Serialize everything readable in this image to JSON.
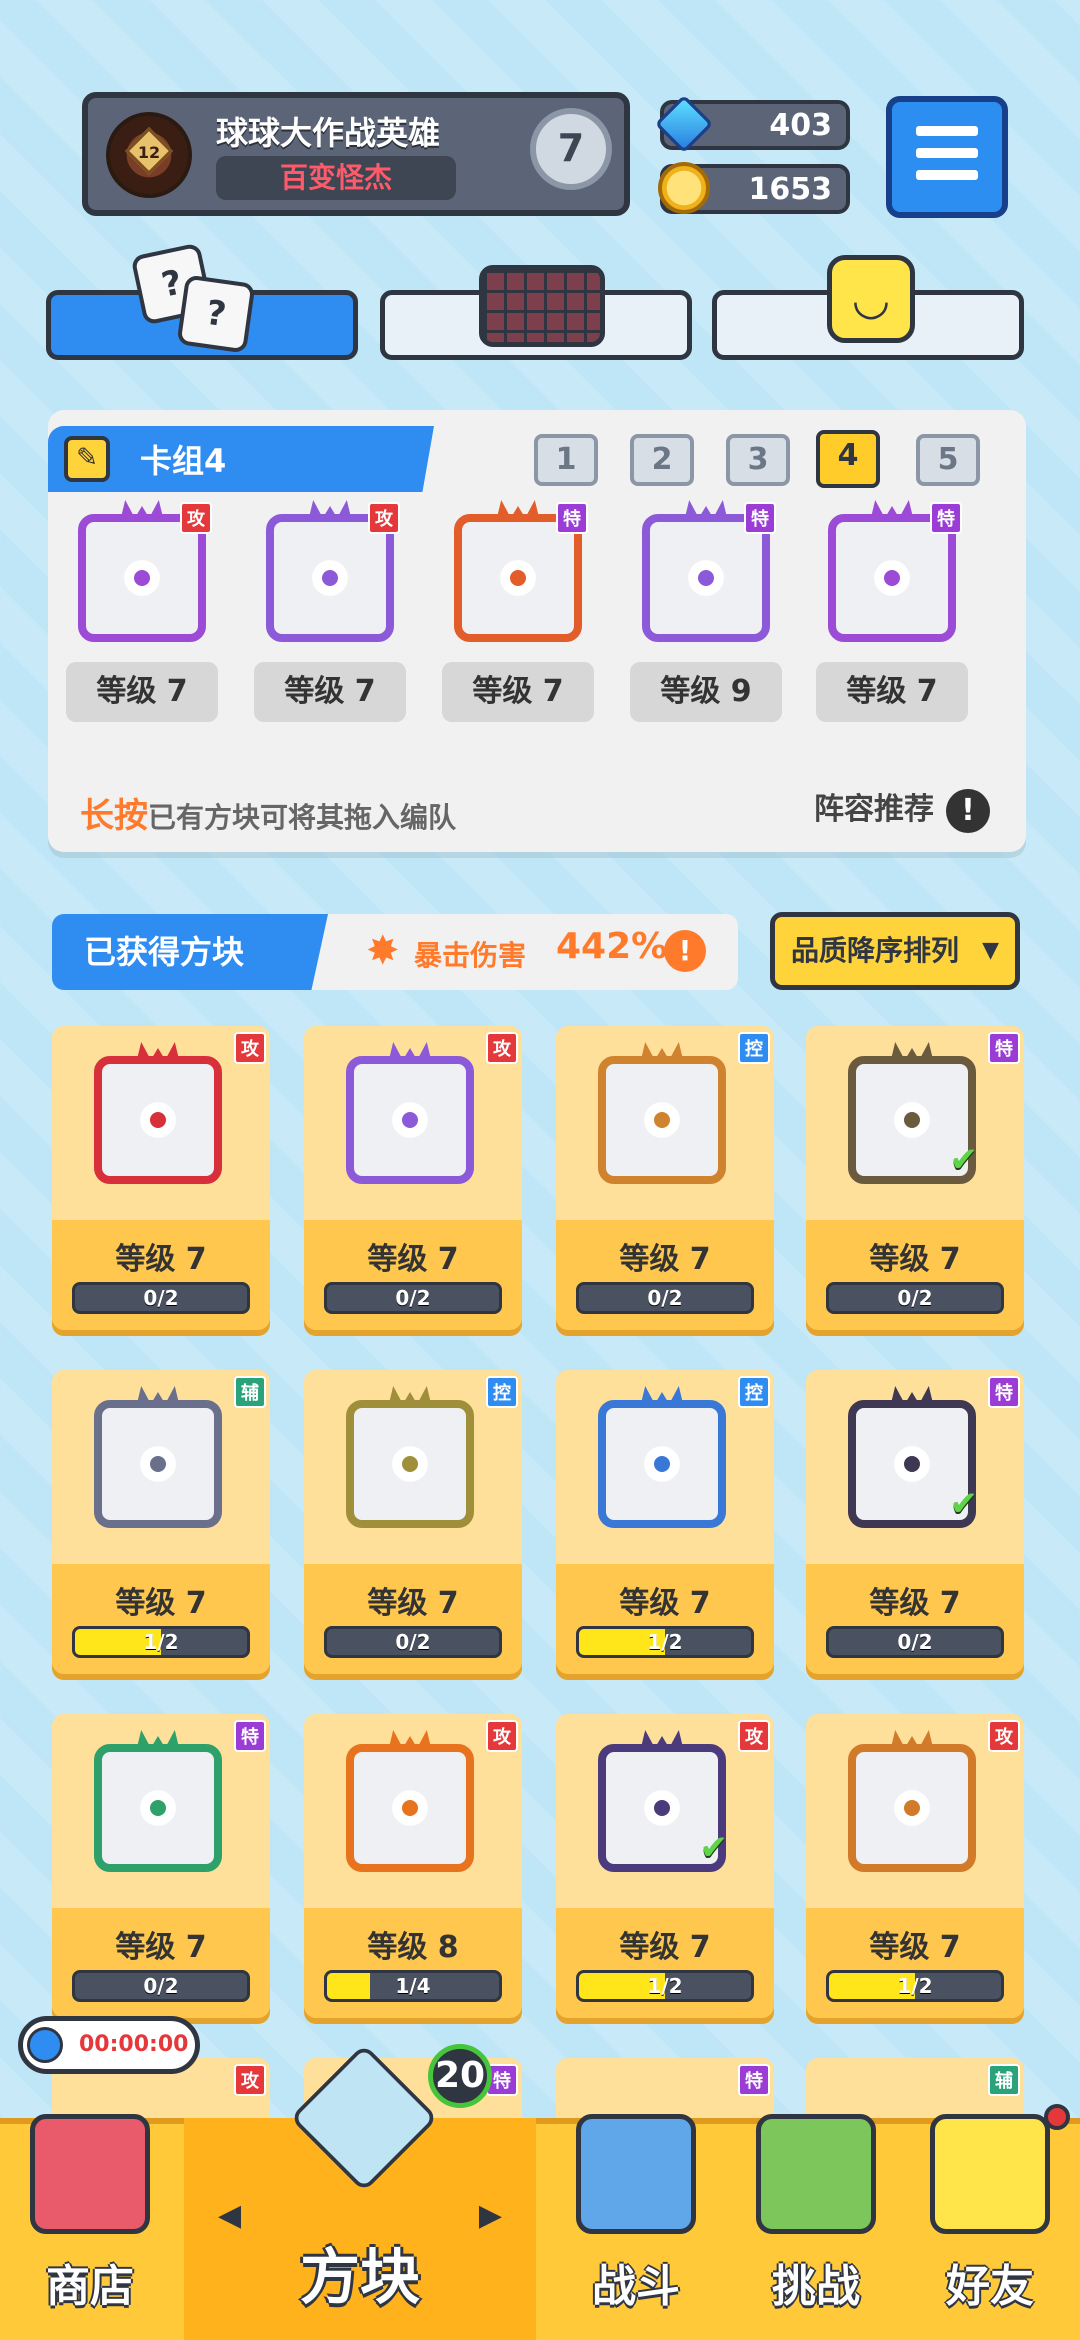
{
  "profile": {
    "level": "12",
    "name": "球球大作战英雄",
    "title": "百变怪杰",
    "rank": "7"
  },
  "currency": {
    "gems": "403",
    "coins": "1653",
    "gem_icon": "gem-icon",
    "coin_icon": "coin-icon"
  },
  "category_tabs": [
    {
      "icon": "dice-icon",
      "active": true
    },
    {
      "icon": "board-grid-icon",
      "active": false
    },
    {
      "icon": "smiley-block-icon",
      "active": false
    }
  ],
  "deck": {
    "title": "卡组4",
    "tabs": [
      "1",
      "2",
      "3",
      "4",
      "5"
    ],
    "active_tab": "4",
    "cards": [
      {
        "tag": "攻",
        "level": "等级 7",
        "color": "#9b4bd6"
      },
      {
        "tag": "攻",
        "level": "等级 7",
        "color": "#8c5ad8"
      },
      {
        "tag": "特",
        "level": "等级 7",
        "color": "#e35d2a"
      },
      {
        "tag": "特",
        "level": "等级 9",
        "color": "#8c5ad8"
      },
      {
        "tag": "特",
        "level": "等级 7",
        "color": "#9b4bd6"
      }
    ],
    "hint_emph": "长按",
    "hint_rest": "已有方块可将其拖入编队",
    "recommend": "阵容推荐"
  },
  "owned": {
    "label": "已获得方块",
    "crit_label": "暴击伤害",
    "crit_value": "442%",
    "sort_label": "品质降序排列",
    "cards": [
      {
        "tag": "攻",
        "level": "等级 7",
        "progress": "0/2",
        "fill": 0,
        "color": "#d8303a",
        "checked": false
      },
      {
        "tag": "攻",
        "level": "等级 7",
        "progress": "0/2",
        "fill": 0,
        "color": "#8c5ad8",
        "checked": false
      },
      {
        "tag": "控",
        "level": "等级 7",
        "progress": "0/2",
        "fill": 0,
        "color": "#d0832f",
        "checked": false
      },
      {
        "tag": "特",
        "level": "等级 7",
        "progress": "0/2",
        "fill": 0,
        "color": "#6a5a3e",
        "checked": true
      },
      {
        "tag": "辅",
        "level": "等级 7",
        "progress": "1/2",
        "fill": 0.5,
        "color": "#6a6f8c",
        "checked": false
      },
      {
        "tag": "控",
        "level": "等级 7",
        "progress": "0/2",
        "fill": 0,
        "color": "#a08f3a",
        "checked": false
      },
      {
        "tag": "控",
        "level": "等级 7",
        "progress": "1/2",
        "fill": 0.5,
        "color": "#3a78d8",
        "checked": false
      },
      {
        "tag": "特",
        "level": "等级 7",
        "progress": "0/2",
        "fill": 0,
        "color": "#3f3852",
        "checked": true
      },
      {
        "tag": "特",
        "level": "等级 7",
        "progress": "0/2",
        "fill": 0,
        "color": "#2ea06a",
        "checked": false
      },
      {
        "tag": "攻",
        "level": "等级 8",
        "progress": "1/4",
        "fill": 0.25,
        "color": "#e8731e",
        "checked": false
      },
      {
        "tag": "攻",
        "level": "等级 7",
        "progress": "1/2",
        "fill": 0.5,
        "color": "#4b3a7c",
        "checked": true
      },
      {
        "tag": "攻",
        "level": "等级 7",
        "progress": "1/2",
        "fill": 0.5,
        "color": "#d07a2a",
        "checked": false
      }
    ],
    "partial_tags": [
      "攻",
      "特",
      "特",
      "辅"
    ]
  },
  "timer": "00:00:00",
  "nav": {
    "shop": "商店",
    "blocks": "方块",
    "blocks_badge": "20",
    "battle": "战斗",
    "challenge": "挑战",
    "friends": "好友"
  }
}
